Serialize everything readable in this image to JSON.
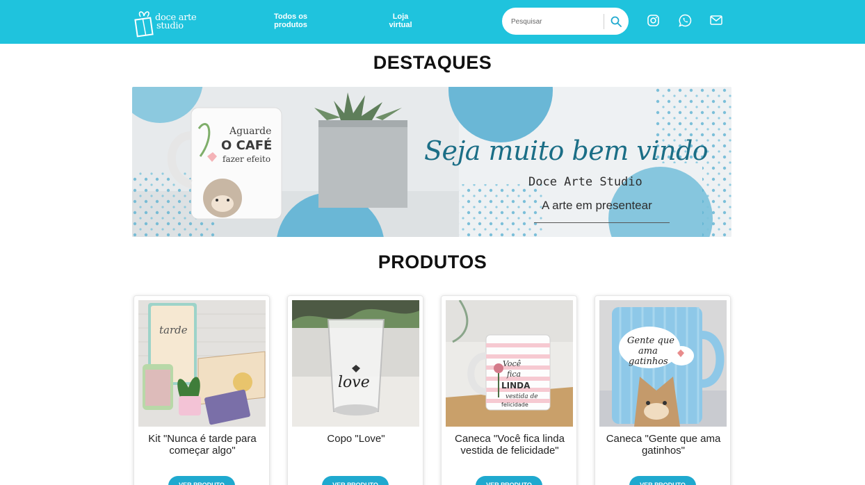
{
  "header": {
    "logo_line1": "doce arte",
    "logo_line2": "studio",
    "nav": [
      {
        "label_line1": "Todos os",
        "label_line2": "produtos"
      },
      {
        "label_line1": "Loja",
        "label_line2": "virtual"
      }
    ],
    "search": {
      "placeholder": "Pesquisar",
      "value": ""
    },
    "social": [
      "instagram-icon",
      "whatsapp-icon",
      "mail-icon"
    ],
    "colors": {
      "bar": "#1fc3dd",
      "accent": "#1fa9cf"
    }
  },
  "highlights": {
    "title": "DESTAQUES",
    "banner": {
      "headline": "Seja muito bem vindo",
      "brand": "Doce Arte Studio",
      "tagline": "A arte em presentear",
      "mug_text_1": "Aguarde",
      "mug_text_2": "O CAFÉ",
      "mug_text_3": "fazer efeito"
    }
  },
  "products": {
    "title": "PRODUTOS",
    "items": [
      {
        "name": "Kit \"Nunca é tarde para começar algo\"",
        "button": "VER PRODUTO",
        "img_text": "tarde"
      },
      {
        "name": "Copo \"Love\"",
        "button": "VER PRODUTO",
        "img_text": "love"
      },
      {
        "name": "Caneca \"Você fica linda vestida de felicidade\"",
        "button": "VER PRODUTO",
        "img_text": "Você fica LINDA vestida de felicidade"
      },
      {
        "name": "Caneca \"Gente que ama gatinhos\"",
        "button": "VER PRODUTO",
        "img_text": "Gente que ama gatinhos"
      }
    ]
  }
}
